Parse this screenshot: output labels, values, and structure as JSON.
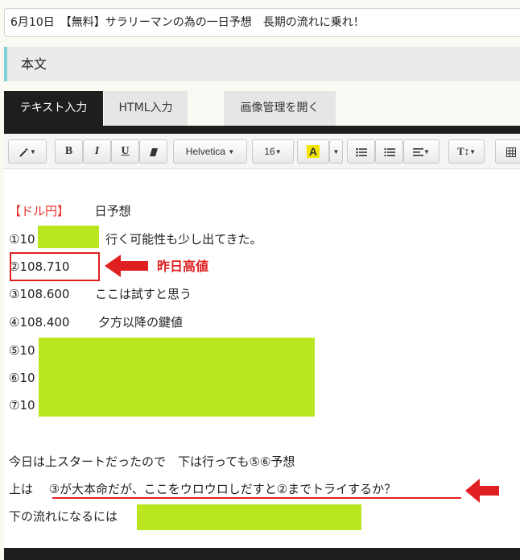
{
  "post": {
    "title": "6月10日　【無料】サラリーマンの為の一日予想　長期の流れに乗れ！",
    "section_heading": "本文"
  },
  "tabs": [
    {
      "label": "テキスト入力",
      "active": true
    },
    {
      "label": "HTML入力",
      "active": false
    },
    {
      "label": "画像管理を開く",
      "active": false
    }
  ],
  "toolbar": {
    "magic_icon": "magic-wand-icon",
    "bold": "B",
    "italic": "I",
    "underline": "U",
    "eraser_icon": "eraser-icon",
    "font_name": "Helvetica",
    "font_size": "16",
    "font_color": "A",
    "font_color_hex": "#f2e600",
    "unordered_list_icon": "bullet-list-icon",
    "ordered_list_icon": "numbered-list-icon",
    "align_icon": "align-icon",
    "text_height_icon": "text-height-icon",
    "table_icon": "table-icon"
  },
  "body": {
    "line1_tag": "【ドル円】",
    "line1_text": "日予想",
    "line2_prefix": "①10",
    "line2_text": "行く可能性も少し出てきた。",
    "line3_text": "②108.710",
    "line3_annotation": "昨日高値",
    "line4_value": "③108.600",
    "line4_text": "ここは試すと思う",
    "line5_value": "④108.400",
    "line5_text": "夕方以降の鍵値",
    "line6_text": "⑤10",
    "line7_text": "⑥10",
    "line8_text": "⑦10",
    "line9_text": "今日は上スタートだったので　下は行っても⑤⑥予想",
    "line10_prefix": "上は",
    "line10_text": "③が大本命だが、ここをウロウロしだすと②までトライするか？",
    "line11_text": "下の流れになるには"
  },
  "colors": {
    "highlight": "#b9e61e",
    "annotation_red": "#e02020",
    "accent_teal": "#7fd3d6"
  }
}
